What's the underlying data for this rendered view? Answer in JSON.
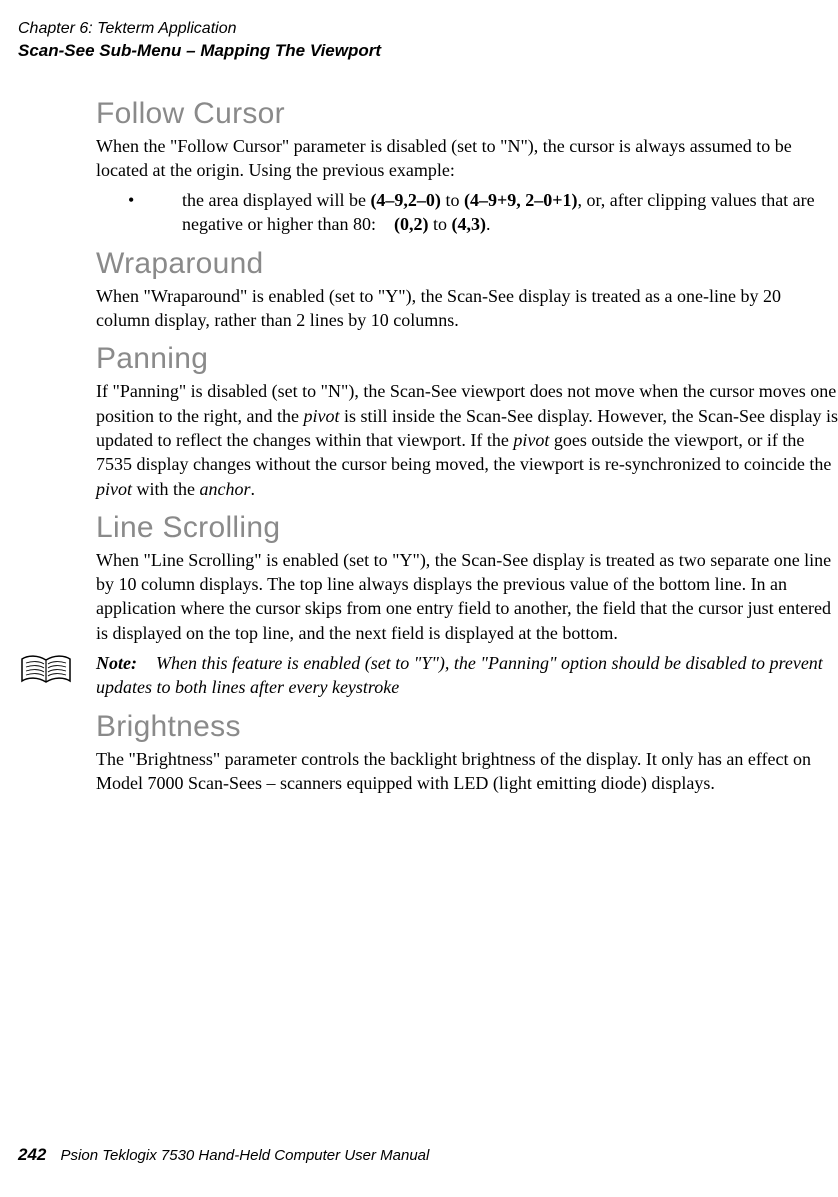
{
  "header": {
    "chapter": "Chapter 6: Tekterm Application",
    "section": "Scan-See Sub-Menu – Mapping The Viewport"
  },
  "sections": {
    "follow_cursor": {
      "title": "Follow Cursor",
      "p1": "When the \"Follow Cursor\" parameter is disabled (set to \"N\"), the cursor is always assumed to be located at the origin. Using the previous example:",
      "bullet_pre": "the area displayed will be ",
      "bullet_b1": "(4–9,2–0)",
      "bullet_mid1": " to ",
      "bullet_b2": "(4–9+9, 2–0+1)",
      "bullet_mid2": ", or, after clipping values that are negative or higher than 80: ",
      "bullet_b3": "(0,2)",
      "bullet_mid3": " to ",
      "bullet_b4": "(4,3)",
      "bullet_end": "."
    },
    "wraparound": {
      "title": "Wraparound",
      "p1": "When \"Wraparound\" is enabled (set to \"Y\"), the Scan-See display is treated as a one-line by 20 column display, rather than 2 lines by 10 columns."
    },
    "panning": {
      "title": "Panning",
      "p1_a": "If \"Panning\" is disabled (set to \"N\"), the Scan-See viewport does not move when the cursor moves one position to the right, and the ",
      "p1_i1": "pivot",
      "p1_b": " is still inside the Scan-See display. However, the Scan-See display is updated to reflect the changes within that viewport. If the ",
      "p1_i2": "pivot",
      "p1_c": " goes outside the viewport, or if the 7535 display changes without the cursor being moved, the viewport is re-synchronized to coincide the ",
      "p1_i3": "pivot",
      "p1_d": " with the ",
      "p1_i4": "anchor",
      "p1_e": "."
    },
    "line_scrolling": {
      "title": "Line Scrolling",
      "p1": "When \"Line Scrolling\" is enabled (set to \"Y\"), the Scan-See display is treated as two separate one line by 10 column displays. The top line always displays the previous value of the bottom line. In an application where the cursor skips from one entry field to another, the field that the cursor just entered is displayed on the top line, and the next field is displayed at the bottom.",
      "note_label": "Note:",
      "note_text": "When this feature is enabled (set to \"Y\"), the \"Panning\" option should be disabled to prevent updates to both lines after every keystroke"
    },
    "brightness": {
      "title": "Brightness",
      "p1": "The \"Brightness\" parameter controls the backlight brightness of the display. It only has an effect on Model 7000 Scan-Sees – scanners equipped with LED (light emitting diode) displays."
    }
  },
  "footer": {
    "page_number": "242",
    "book_title": "Psion Teklogix 7530 Hand-Held Computer User Manual"
  }
}
